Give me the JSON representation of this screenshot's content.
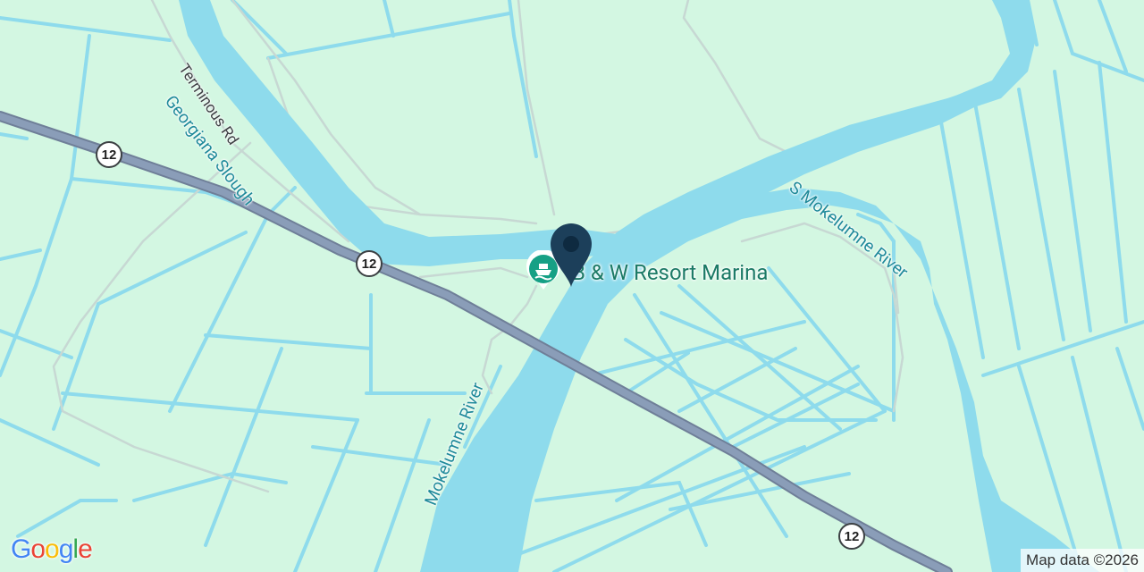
{
  "map": {
    "poi": {
      "name": "B & W Resort Marina",
      "icon": "boat-marina-icon"
    },
    "marker": {
      "icon": "location-pin-icon",
      "color": "#1c3f5a"
    },
    "waterways": {
      "georgiana_slough": "Georgiana Slough",
      "mokelumne_river": "Mokelumne River",
      "s_mokelumne_river": "S Mokelumne River"
    },
    "roads": {
      "terminous_rd": "Terminous Rd",
      "route_shield_1": "12",
      "route_shield_2": "12",
      "route_shield_3": "12"
    },
    "logo": "Google",
    "attribution": "Map data ©2026",
    "colors": {
      "land": "#d3f7e2",
      "water": "#8edbec",
      "highway": "#8a9db8",
      "poi_green": "#16a085"
    }
  }
}
